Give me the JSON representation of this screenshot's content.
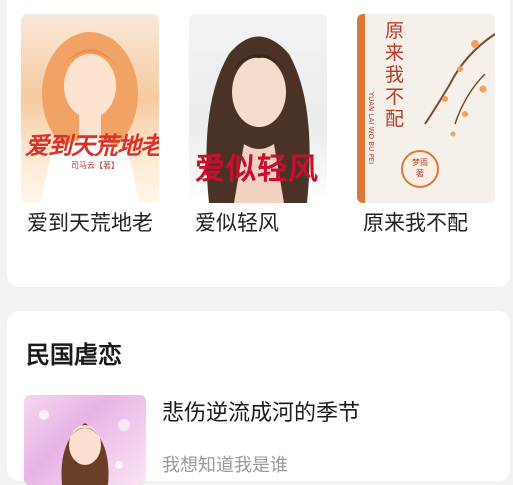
{
  "books": [
    {
      "title": "爱到天荒地老",
      "cover_text": "爱到天荒地老",
      "cover_author": "司马云【著】"
    },
    {
      "title": "爱似轻风",
      "cover_text": "爱似轻风"
    },
    {
      "title": "原来我不配",
      "cover_text": "原来我不配",
      "cover_author": "梦雨",
      "cover_author_suffix": "著",
      "cover_pinyin": "YUAN LAI WO BU PEI"
    }
  ],
  "section": {
    "title": "民国虐恋",
    "items": [
      {
        "title": "悲伤逆流成河的季节",
        "desc": "我想知道我是谁"
      }
    ]
  },
  "colors": {
    "page_bg": "#f2f2f2",
    "card_bg": "#ffffff",
    "cover1_text": "#d8322a",
    "cover2_text": "#c8102e",
    "cover3_accent": "#d87a3a"
  }
}
